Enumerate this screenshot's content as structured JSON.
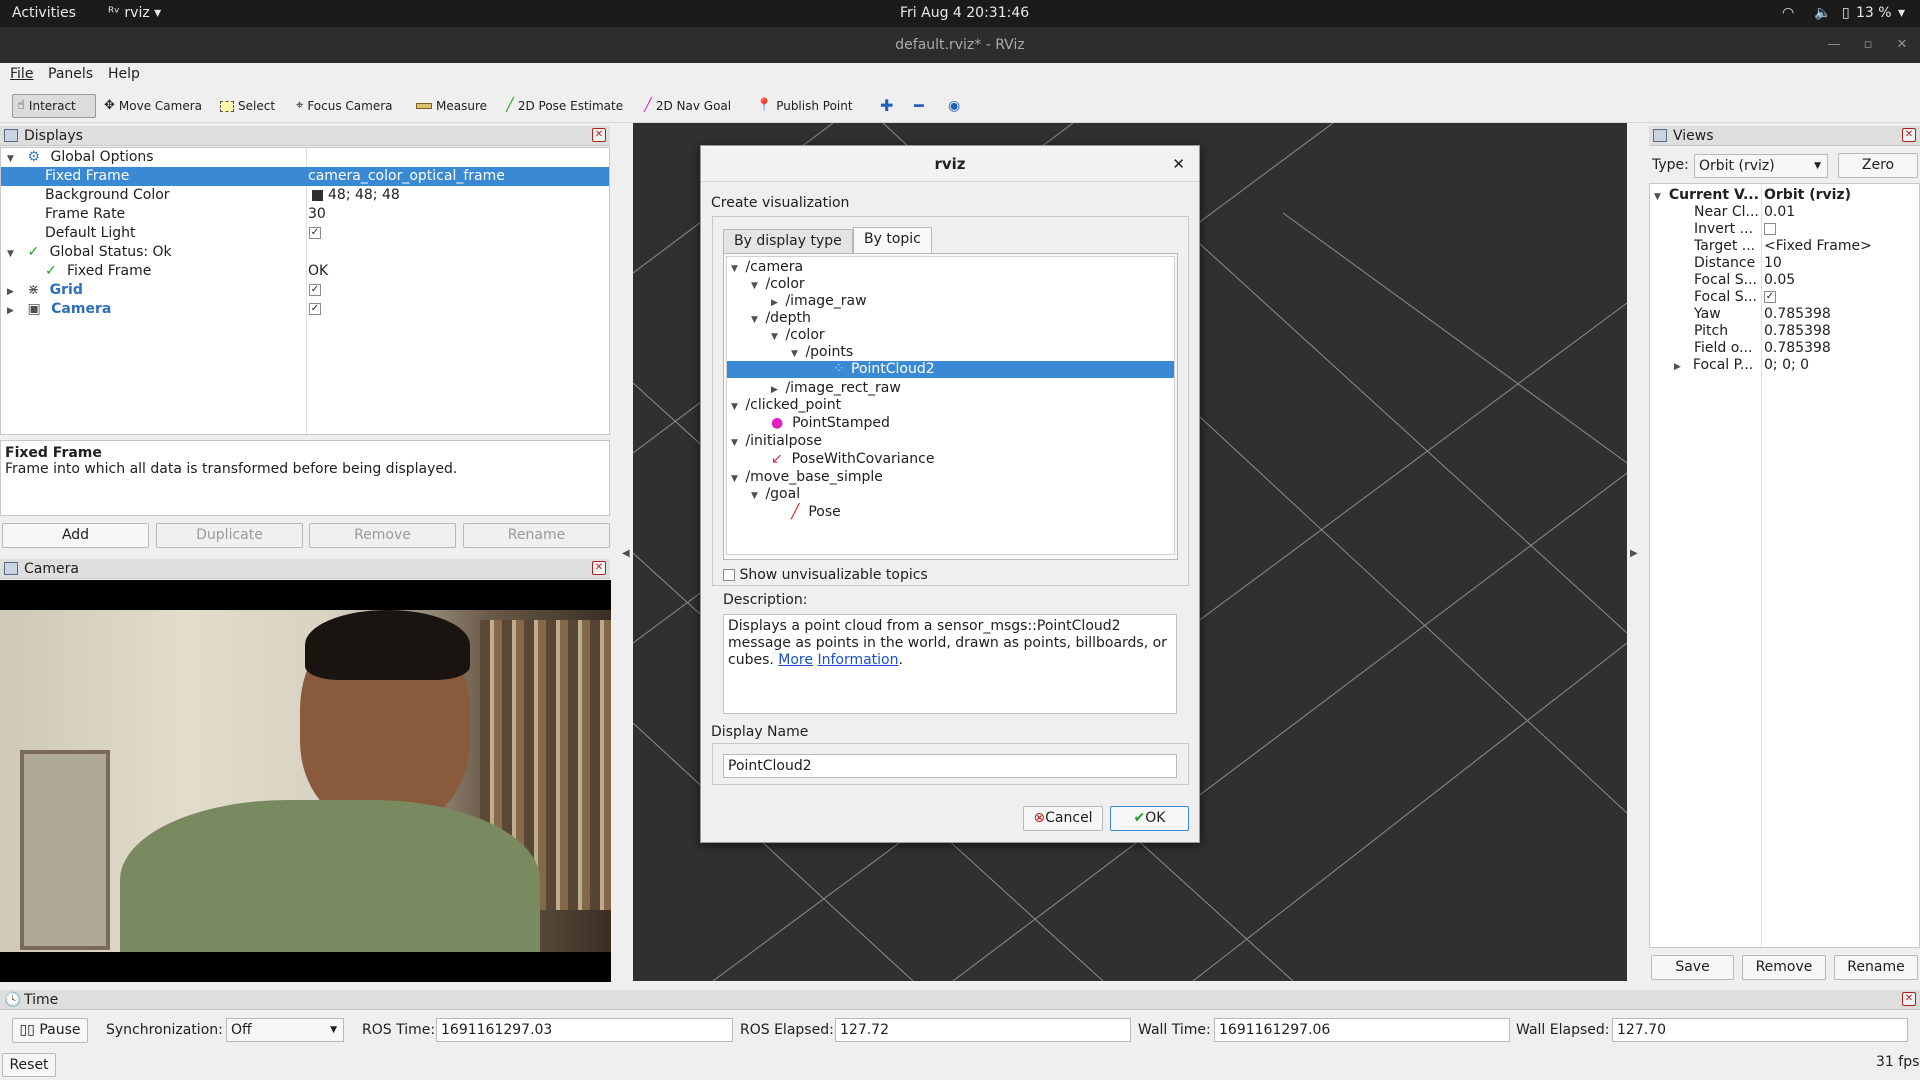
{
  "topbar": {
    "activities": "Activities",
    "app": "rviz",
    "clock": "Fri Aug 4  20:31:46",
    "battery": "13 %"
  },
  "window": {
    "title": "default.rviz* - RViz"
  },
  "menu": {
    "file": "File",
    "panels": "Panels",
    "help": "Help"
  },
  "toolbar": {
    "interact": "Interact",
    "move_camera": "Move Camera",
    "select": "Select",
    "focus_camera": "Focus Camera",
    "measure": "Measure",
    "pose_estimate": "2D Pose Estimate",
    "nav_goal": "2D Nav Goal",
    "publish_point": "Publish Point"
  },
  "displays": {
    "title": "Displays",
    "rows": [
      {
        "label": "Global Options",
        "value": ""
      },
      {
        "label": "Fixed Frame",
        "value": "camera_color_optical_frame"
      },
      {
        "label": "Background Color",
        "value": "48; 48; 48"
      },
      {
        "label": "Frame Rate",
        "value": "30"
      },
      {
        "label": "Default Light",
        "value": ""
      },
      {
        "label": "Global Status: Ok",
        "value": ""
      },
      {
        "label": "Fixed Frame",
        "value": "OK"
      },
      {
        "label": "Grid",
        "value": ""
      },
      {
        "label": "Camera",
        "value": ""
      }
    ],
    "desc_title": "Fixed Frame",
    "desc_text": "Frame into which all data is transformed before being displayed.",
    "buttons": {
      "add": "Add",
      "duplicate": "Duplicate",
      "remove": "Remove",
      "rename": "Rename"
    }
  },
  "camera_panel": {
    "title": "Camera"
  },
  "dialog": {
    "title": "rviz",
    "heading": "Create visualization",
    "tabs": [
      "By display type",
      "By topic"
    ],
    "tree": [
      "/camera",
      "/color",
      "/image_raw",
      "/depth",
      "/color",
      "/points",
      "PointCloud2",
      "/image_rect_raw",
      "/clicked_point",
      "PointStamped",
      "/initialpose",
      "PoseWithCovariance",
      "/move_base_simple",
      "/goal",
      "Pose"
    ],
    "show_unvis": "Show unvisualizable topics",
    "desc_label": "Description:",
    "desc_text": "Displays a point cloud from a sensor_msgs::PointCloud2 message as points in the world, drawn as points, billboards, or cubes.",
    "desc_link1": "More",
    "desc_link2": "Information",
    "name_label": "Display Name",
    "name_value": "PointCloud2",
    "cancel": "Cancel",
    "ok": "OK"
  },
  "views": {
    "title": "Views",
    "type_label": "Type:",
    "type_value": "Orbit (rviz)",
    "zero": "Zero",
    "rows": [
      {
        "label": "Current V...",
        "value": "Orbit (rviz)"
      },
      {
        "label": "Near Cl...",
        "value": "0.01"
      },
      {
        "label": "Invert ...",
        "value": ""
      },
      {
        "label": "Target ...",
        "value": "<Fixed Frame>"
      },
      {
        "label": "Distance",
        "value": "10"
      },
      {
        "label": "Focal S...",
        "value": "0.05"
      },
      {
        "label": "Focal S...",
        "value": ""
      },
      {
        "label": "Yaw",
        "value": "0.785398"
      },
      {
        "label": "Pitch",
        "value": "0.785398"
      },
      {
        "label": "Field o...",
        "value": "0.785398"
      },
      {
        "label": "Focal P...",
        "value": "0; 0; 0"
      }
    ],
    "save": "Save",
    "remove": "Remove",
    "rename": "Rename"
  },
  "time": {
    "title": "Time",
    "pause": "Pause",
    "sync_label": "Synchronization:",
    "sync_value": "Off",
    "ros_time_label": "ROS Time:",
    "ros_time": "1691161297.03",
    "ros_elapsed_label": "ROS Elapsed:",
    "ros_elapsed": "127.72",
    "wall_time_label": "Wall Time:",
    "wall_time": "1691161297.06",
    "wall_elapsed_label": "Wall Elapsed:",
    "wall_elapsed": "127.70",
    "reset": "Reset",
    "fps": "31 fps"
  }
}
